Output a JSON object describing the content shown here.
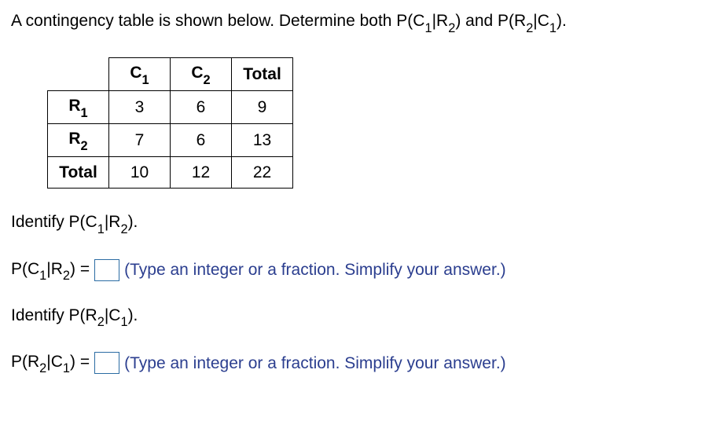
{
  "question": {
    "text_pre": "A contingency table is shown below. Determine both P(C",
    "sub1": "1",
    "mid1": "|R",
    "sub2": "2",
    "mid2": ") and P(R",
    "sub3": "2",
    "mid3": "|C",
    "sub4": "1",
    "end": ")."
  },
  "table": {
    "headers": {
      "c1_base": "C",
      "c1_sub": "1",
      "c2_base": "C",
      "c2_sub": "2",
      "total": "Total"
    },
    "rows": [
      {
        "label_base": "R",
        "label_sub": "1",
        "c1": "3",
        "c2": "6",
        "total": "9"
      },
      {
        "label_base": "R",
        "label_sub": "2",
        "c1": "7",
        "c2": "6",
        "total": "13"
      },
      {
        "label_base": "Total",
        "label_sub": "",
        "c1": "10",
        "c2": "12",
        "total": "22"
      }
    ]
  },
  "prompt1": {
    "pre": "Identify P(C",
    "s1": "1",
    "mid": "|R",
    "s2": "2",
    "end": ")."
  },
  "answer1": {
    "pre": "P(C",
    "s1": "1",
    "mid": "|R",
    "s2": "2",
    "eq": ") =",
    "hint": "(Type an integer or a fraction. Simplify your answer.)"
  },
  "prompt2": {
    "pre": "Identify P(R",
    "s1": "2",
    "mid": "|C",
    "s2": "1",
    "end": ")."
  },
  "answer2": {
    "pre": "P(R",
    "s1": "2",
    "mid": "|C",
    "s2": "1",
    "eq": ") =",
    "hint": "(Type an integer or a fraction. Simplify your answer.)"
  }
}
